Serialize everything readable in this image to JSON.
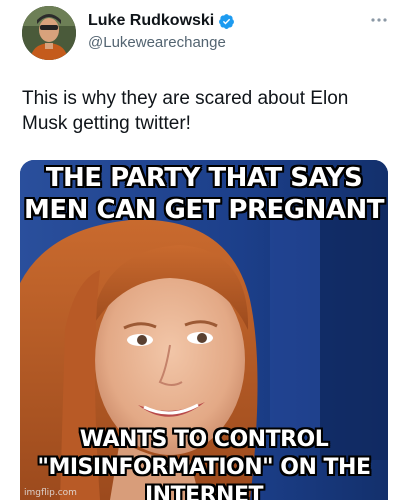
{
  "author": {
    "display_name": "Luke Rudkowski",
    "handle": "@Lukewearechange",
    "verified": true,
    "avatar_icon": "avatar-photo"
  },
  "tweet": {
    "text": "This is why they are scared about Elon Musk getting twitter!"
  },
  "meme": {
    "top_line_1": "THE PARTY THAT SAYS",
    "top_line_2": "MEN CAN GET PREGNANT",
    "bottom_line_1": "WANTS TO CONTROL",
    "bottom_line_2": "\"MISINFORMATION\" ON THE INTERNET",
    "watermark": "imgflip.com"
  },
  "colors": {
    "verified_blue": "#1d9bf0",
    "handle_gray": "#536471",
    "meme_background_blue": "#1a3f8a"
  }
}
